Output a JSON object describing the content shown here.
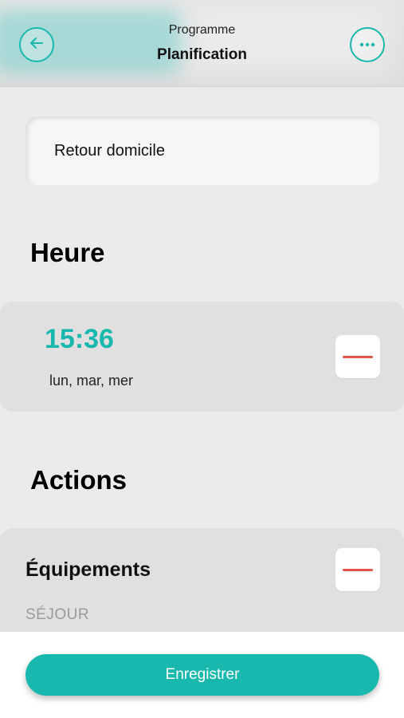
{
  "header": {
    "subtitle": "Programme",
    "title": "Planification",
    "back_icon": "arrow-left-icon",
    "more_icon": "more-horizontal-icon",
    "accent_color": "#19b8ae"
  },
  "name_field": {
    "value": "Retour domicile"
  },
  "sections": {
    "time_title": "Heure",
    "actions_title": "Actions"
  },
  "schedule": {
    "time": "15:36",
    "days": "lun, mar, mer",
    "remove_icon": "minus-icon"
  },
  "equipments": {
    "title": "Équipements",
    "room": "SÉJOUR",
    "remove_icon": "minus-icon"
  },
  "footer": {
    "save_label": "Enregistrer"
  },
  "colors": {
    "accent": "#19b8ae",
    "danger": "#e25549",
    "background": "#ebebeb"
  }
}
